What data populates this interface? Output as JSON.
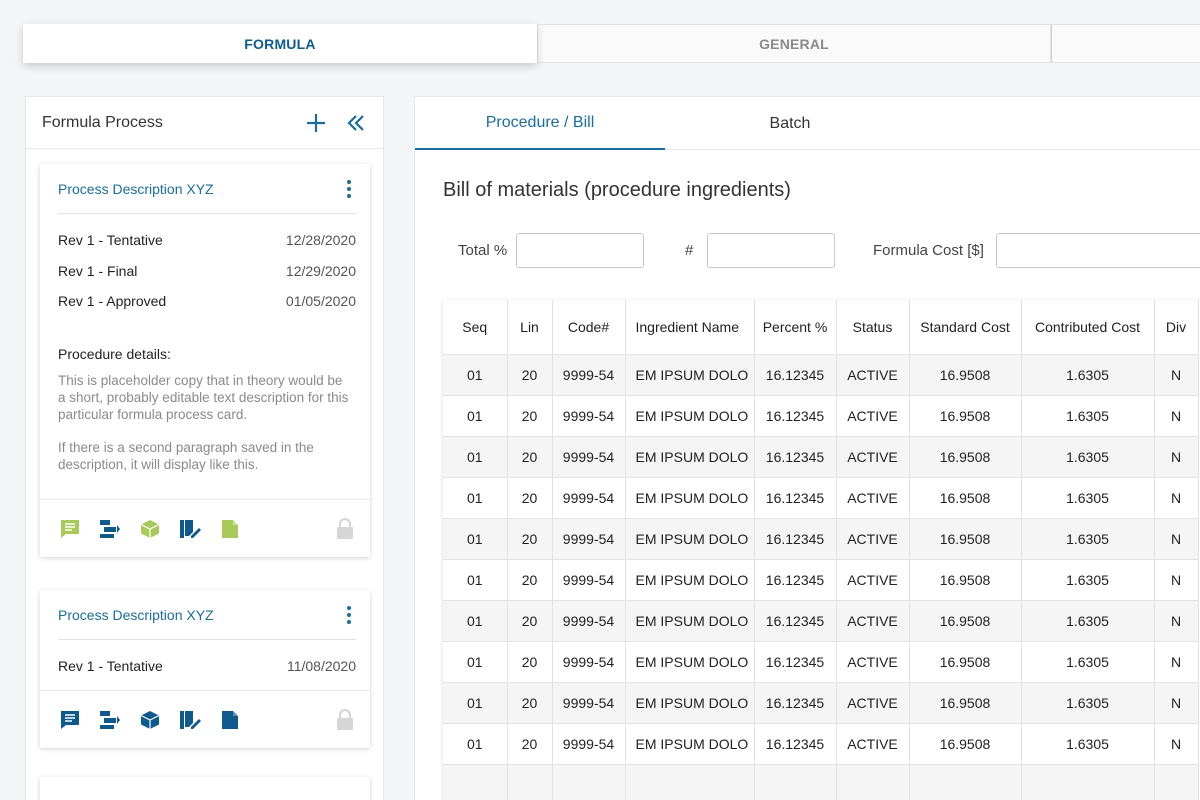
{
  "top_tabs": [
    {
      "label": "FORMULA",
      "active": true
    },
    {
      "label": "GENERAL",
      "active": false
    },
    {
      "label": "",
      "active": false
    }
  ],
  "left_panel": {
    "title": "Formula Process",
    "add_icon": "plus-icon",
    "collapse_icon": "double-chevron-left-icon",
    "cards": [
      {
        "title": "Process Description XYZ",
        "revisions": [
          {
            "name": "Rev 1 - Tentative",
            "date": "12/28/2020"
          },
          {
            "name": "Rev 1 - Final",
            "date": "12/29/2020"
          },
          {
            "name": "Rev 1 - Approved",
            "date": "01/05/2020"
          }
        ],
        "procedure_label": "Procedure details:",
        "procedure_paragraphs": [
          "This is placeholder copy that in theory would be a short, probably editable text description for this particular formula process card.",
          "If there is a second paragraph saved in the description, it will display like this."
        ],
        "footer_icons": [
          "comment-icon",
          "process-flow-icon",
          "package-box-icon",
          "document-edit-icon",
          "file-icon",
          "lock-icon"
        ],
        "icon_color": "#a9c95a"
      },
      {
        "title": "Process Description XYZ",
        "revisions": [
          {
            "name": "Rev 1 - Tentative",
            "date": "11/08/2020"
          }
        ],
        "footer_icons": [
          "comment-icon",
          "process-flow-icon",
          "package-box-icon",
          "document-edit-icon",
          "file-icon",
          "lock-icon"
        ],
        "icon_color": "#0f5a8c"
      }
    ]
  },
  "right_panel": {
    "tabs": [
      {
        "label": "Procedure / Bill",
        "active": true
      },
      {
        "label": "Batch",
        "active": false
      }
    ],
    "section_title": "Bill of materials (procedure ingredients)",
    "filters": {
      "total_label": "Total %",
      "total_value": "",
      "count_label": "#",
      "count_value": "",
      "cost_label": "Formula Cost [$]",
      "cost_value": ""
    },
    "table": {
      "columns": [
        "Seq",
        "Lin",
        "Code#",
        "Ingredient Name",
        "Percent %",
        "Status",
        "Standard Cost",
        "Contributed Cost",
        "Div"
      ],
      "rows": [
        [
          "01",
          "20",
          "9999-54",
          "EM IPSUM DOLO",
          "16.12345",
          "ACTIVE",
          "16.9508",
          "1.6305",
          "N"
        ],
        [
          "01",
          "20",
          "9999-54",
          "EM IPSUM DOLO",
          "16.12345",
          "ACTIVE",
          "16.9508",
          "1.6305",
          "N"
        ],
        [
          "01",
          "20",
          "9999-54",
          "EM IPSUM DOLO",
          "16.12345",
          "ACTIVE",
          "16.9508",
          "1.6305",
          "N"
        ],
        [
          "01",
          "20",
          "9999-54",
          "EM IPSUM DOLO",
          "16.12345",
          "ACTIVE",
          "16.9508",
          "1.6305",
          "N"
        ],
        [
          "01",
          "20",
          "9999-54",
          "EM IPSUM DOLO",
          "16.12345",
          "ACTIVE",
          "16.9508",
          "1.6305",
          "N"
        ],
        [
          "01",
          "20",
          "9999-54",
          "EM IPSUM DOLO",
          "16.12345",
          "ACTIVE",
          "16.9508",
          "1.6305",
          "N"
        ],
        [
          "01",
          "20",
          "9999-54",
          "EM IPSUM DOLO",
          "16.12345",
          "ACTIVE",
          "16.9508",
          "1.6305",
          "N"
        ],
        [
          "01",
          "20",
          "9999-54",
          "EM IPSUM DOLO",
          "16.12345",
          "ACTIVE",
          "16.9508",
          "1.6305",
          "N"
        ],
        [
          "01",
          "20",
          "9999-54",
          "EM IPSUM DOLO",
          "16.12345",
          "ACTIVE",
          "16.9508",
          "1.6305",
          "N"
        ],
        [
          "01",
          "20",
          "9999-54",
          "EM IPSUM DOLO",
          "16.12345",
          "ACTIVE",
          "16.9508",
          "1.6305",
          "N"
        ],
        [
          "",
          "",
          "",
          "",
          "",
          "",
          "",
          "",
          ""
        ]
      ]
    }
  },
  "colors": {
    "accent": "#1a6d9e",
    "accent_dark": "#0f5a8c",
    "green_icon": "#a9c95a",
    "lock_disabled": "#d6d6d6"
  }
}
